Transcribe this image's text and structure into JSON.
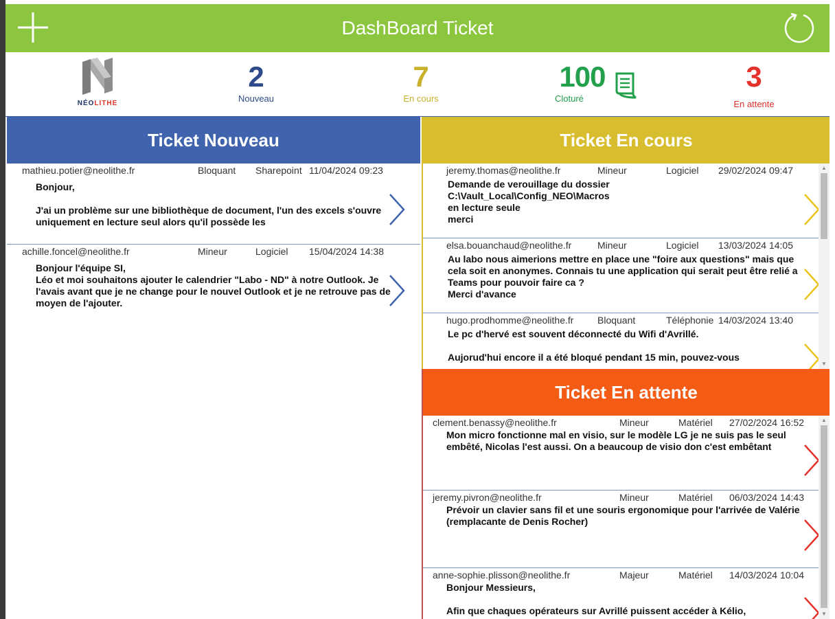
{
  "header": {
    "title": "DashBoard Ticket",
    "add_icon": "plus-icon",
    "refresh_icon": "refresh-icon",
    "color": "#8cc63f"
  },
  "logo": {
    "brand_left": "NÉO",
    "brand_right": "LITHE"
  },
  "stats": {
    "nouveau": {
      "count": "2",
      "label": "Nouveau",
      "color": "#2e4a8b"
    },
    "en_cours": {
      "count": "7",
      "label": "En cours",
      "color": "#c9b12d"
    },
    "cloture": {
      "count": "100",
      "label": "Cloturé",
      "color": "#22a04b",
      "icon": "document-icon"
    },
    "en_attente": {
      "count": "3",
      "label": "En attente",
      "color": "#e2322b"
    }
  },
  "panels": {
    "nouveau": {
      "title": "Ticket Nouveau",
      "color": "#3f63ad",
      "items": [
        {
          "email": "mathieu.potier@neolithe.fr",
          "priority": "Bloquant",
          "category": "Sharepoint",
          "date": "11/04/2024 09:23",
          "message": "Bonjour,\n\nJ'ai un problème sur une bibliothèque de document, l'un des excels s'ouvre uniquement en lecture seul alors qu'il possède les"
        },
        {
          "email": "achille.foncel@neolithe.fr",
          "priority": "Mineur",
          "category": "Logiciel",
          "date": "15/04/2024 14:38",
          "message": "Bonjour l'équipe SI,\nLéo et moi souhaitons ajouter le calendrier \"Labo - ND\" à notre Outlook. Je l'avais avant que je ne change pour le nouvel Outlook et je ne retrouve pas de moyen de l'ajouter."
        }
      ]
    },
    "en_cours": {
      "title": "Ticket En cours",
      "color": "#d8be2f",
      "items": [
        {
          "email": "jeremy.thomas@neolithe.fr",
          "priority": "Mineur",
          "category": "Logiciel",
          "date": "29/02/2024 09:47",
          "message": "Demande de verouillage du dossier\nC:\\Vault_Local\\Config_NEO\\Macros\nen lecture seule\nmerci"
        },
        {
          "email": "elsa.bouanchaud@neolithe.fr",
          "priority": "Mineur",
          "category": "Logiciel",
          "date": "13/03/2024 14:05",
          "message": "Au labo nous aimerions mettre en place une \"foire aux questions\" mais que cela soit en anonymes. Connais tu une application qui serait peut être relié a Teams pour pouvoir faire ca ?\nMerci d'avance"
        },
        {
          "email": "hugo.prodhomme@neolithe.fr",
          "priority": "Bloquant",
          "category": "Téléphonie",
          "date": "14/03/2024 13:40",
          "message": "Le pc d'hervé est souvent déconnecté du Wifi d'Avrillé.\n\nAujorud'hui encore il a été bloqué pendant 15 min, pouvez-vous"
        }
      ]
    },
    "en_attente": {
      "title": "Ticket En attente",
      "color": "#f45b15",
      "items": [
        {
          "email": "clement.benassy@neolithe.fr",
          "priority": "Mineur",
          "category": "Matériel",
          "date": "27/02/2024 16:52",
          "message": "Mon micro fonctionne mal en visio, sur le modèle LG je ne suis pas le seul embêté, Nicolas l'est aussi. On a beaucoup de visio don c'est embêtant"
        },
        {
          "email": "jeremy.pivron@neolithe.fr",
          "priority": "Mineur",
          "category": "Matériel",
          "date": "06/03/2024 14:43",
          "message": "Prévoir un clavier sans fil et une souris ergonomique pour l'arrivée de Valérie (remplacante de Denis Rocher)"
        },
        {
          "email": "anne-sophie.plisson@neolithe.fr",
          "priority": "Majeur",
          "category": "Matériel",
          "date": "14/03/2024 10:04",
          "message": "Bonjour Messieurs,\n\nAfin que chaques opérateurs sur Avrillé puissent accéder à Kélio,"
        }
      ]
    }
  }
}
